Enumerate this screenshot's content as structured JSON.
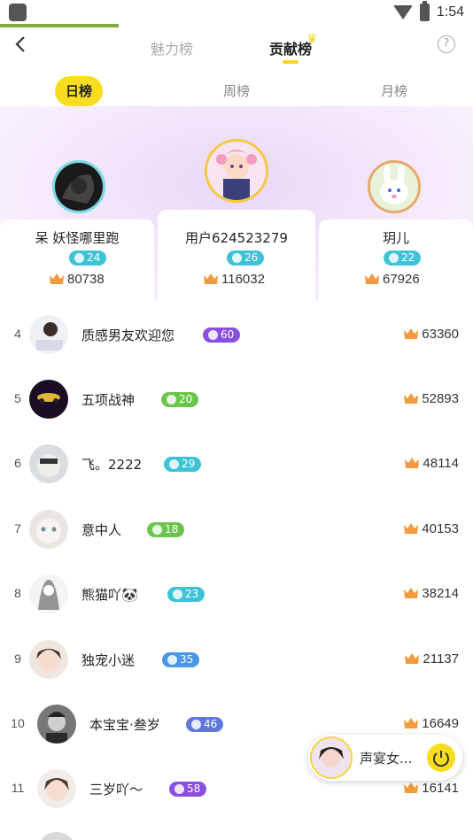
{
  "status_bar": {
    "time": "1:54"
  },
  "nav": {
    "back_icon": "back-arrow-icon",
    "tabs": [
      {
        "label": "魅力榜",
        "active": false
      },
      {
        "label": "贡献榜",
        "active": true
      }
    ],
    "help_icon": "question-circle-icon",
    "help_glyph": "?"
  },
  "periods": [
    {
      "label": "日榜",
      "active": true
    },
    {
      "label": "周榜",
      "active": false
    },
    {
      "label": "月榜",
      "active": false
    }
  ],
  "podium": {
    "left": {
      "name": "呆 妖怪哪里跑",
      "level": "24",
      "score": "80738"
    },
    "center": {
      "name": "用户624523279",
      "level": "26",
      "score": "116032"
    },
    "right": {
      "name": "玥儿",
      "level": "22",
      "score": "67926"
    }
  },
  "ranks": [
    {
      "rank": "4",
      "name": "质感男友欢迎您",
      "level": "60",
      "level_color": "purple",
      "score": "63360"
    },
    {
      "rank": "5",
      "name": "五项战神",
      "level": "20",
      "level_color": "green",
      "score": "52893"
    },
    {
      "rank": "6",
      "name": "飞。2222",
      "level": "29",
      "level_color": "cyan",
      "score": "48114"
    },
    {
      "rank": "7",
      "name": "意中人",
      "level": "18",
      "level_color": "green",
      "score": "40153"
    },
    {
      "rank": "8",
      "name": "熊猫吖🐼",
      "level": "23",
      "level_color": "cyan",
      "score": "38214"
    },
    {
      "rank": "9",
      "name": "独宠小迷",
      "level": "35",
      "level_color": "blue",
      "score": "21137"
    },
    {
      "rank": "10",
      "name": "本宝宝·叁岁",
      "level": "46",
      "level_color": "indigo",
      "score": "16649"
    },
    {
      "rank": "11",
      "name": "三岁吖～",
      "level": "58",
      "level_color": "purple",
      "score": "16141"
    }
  ],
  "mini_player": {
    "title": "声宴女...",
    "power_icon": "power-icon"
  },
  "colors": {
    "accent_yellow": "#f7dd1d",
    "crown_orange": "#f19a3e",
    "level_cyan": "#3ec3d6",
    "level_green": "#6cc54b",
    "level_purple": "#8a4fe0"
  }
}
